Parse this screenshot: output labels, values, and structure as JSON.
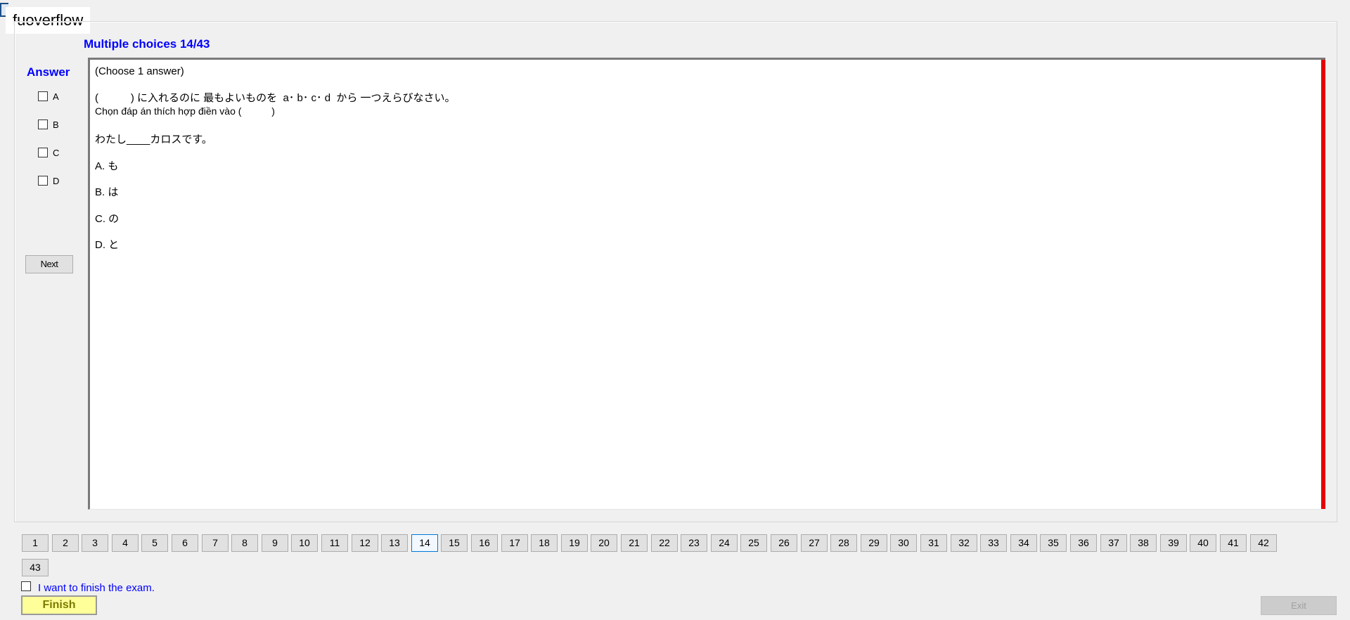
{
  "watermark": "fuoverflow",
  "header": {
    "title": "Multiple choices 14/43"
  },
  "answer_panel": {
    "heading": "Answer",
    "options": [
      "A",
      "B",
      "C",
      "D"
    ],
    "next_label": "Next"
  },
  "question": {
    "instruction": "(Choose 1 answer)",
    "prompt_jp": "(           ) に入れるのに 最もよいものを  a･ b･ c･ d  から 一つえらびなさい。",
    "prompt_vi": "Chọn đáp án thích hợp điền vào (           )",
    "sentence": "わたし____カロスです。",
    "choices": [
      "A. も",
      "B. は",
      "C. の",
      "D. と"
    ]
  },
  "navigation": {
    "current": 14,
    "total": 43,
    "labels": [
      "1",
      "2",
      "3",
      "4",
      "5",
      "6",
      "7",
      "8",
      "9",
      "10",
      "11",
      "12",
      "13",
      "14",
      "15",
      "16",
      "17",
      "18",
      "19",
      "20",
      "21",
      "22",
      "23",
      "24",
      "25",
      "26",
      "27",
      "28",
      "29",
      "30",
      "31",
      "32",
      "33",
      "34",
      "35",
      "36",
      "37",
      "38",
      "39",
      "40",
      "41",
      "42",
      "43"
    ]
  },
  "footer": {
    "finish_checkbox_label": "I want to finish the exam.",
    "finish_label": "Finish",
    "exit_label": "Exit"
  },
  "colors": {
    "accent_blue": "#0000ff",
    "scroll_indicator": "#e80000",
    "finish_bg": "#ffff99",
    "current_question_border": "#0078d7"
  }
}
